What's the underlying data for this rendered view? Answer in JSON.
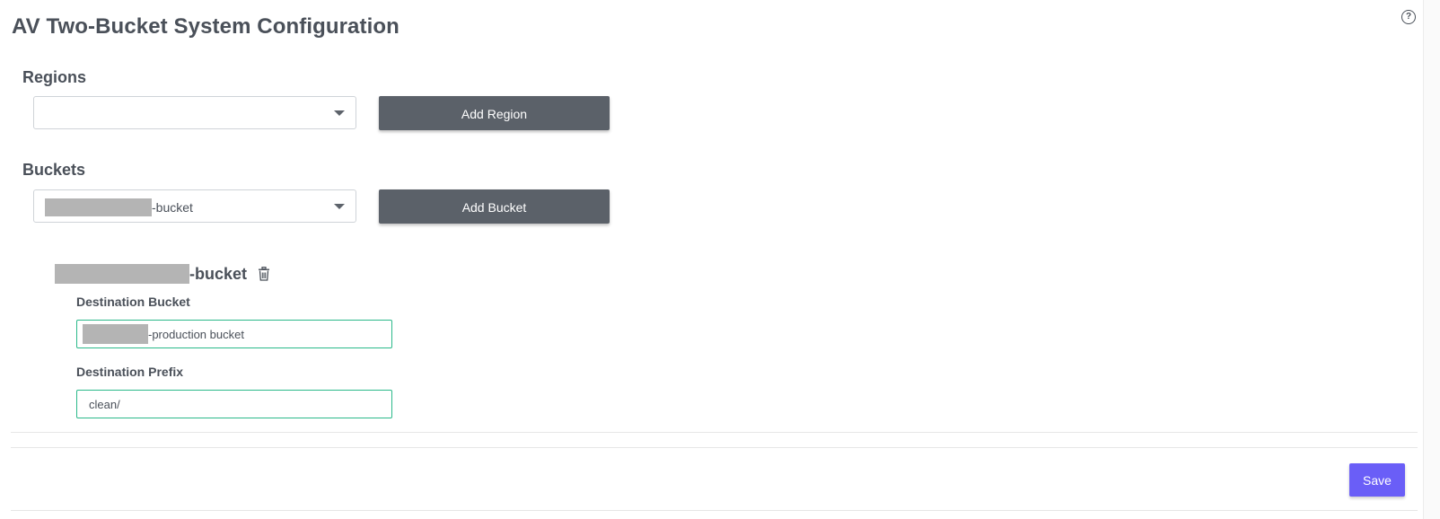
{
  "page": {
    "title": "AV Two-Bucket System Configuration",
    "help_icon": "question-circle-icon"
  },
  "regions": {
    "heading": "Regions",
    "selected_value": "",
    "add_button_label": "Add Region"
  },
  "buckets": {
    "heading": "Buckets",
    "selected_value_suffix": "-bucket",
    "add_button_label": "Add Bucket"
  },
  "bucket_config": {
    "name_suffix": "-bucket",
    "delete_icon": "trash-icon",
    "destination_bucket": {
      "label": "Destination Bucket",
      "value_suffix": "-production bucket"
    },
    "destination_prefix": {
      "label": "Destination Prefix",
      "value": "clean/"
    }
  },
  "footer": {
    "save_label": "Save"
  },
  "colors": {
    "text": "#4a5059",
    "dark_button": "#5b6169",
    "save_button": "#6a5ef7",
    "input_border_active": "#2bb98a",
    "redacted": "#b4b4b4"
  }
}
